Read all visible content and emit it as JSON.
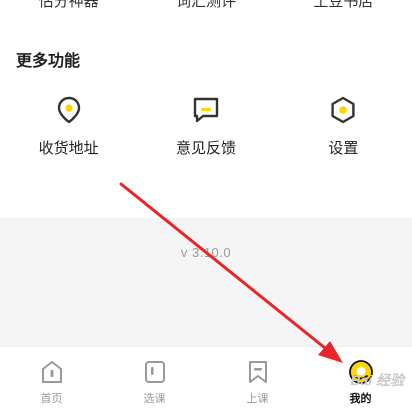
{
  "top_row": {
    "items": [
      "估分神器",
      "词汇测评",
      "土豆书店"
    ]
  },
  "more_features": {
    "title": "更多功能",
    "items": [
      {
        "label": "收货地址",
        "icon": "location-pin-icon"
      },
      {
        "label": "意见反馈",
        "icon": "feedback-icon"
      },
      {
        "label": "设置",
        "icon": "settings-icon"
      }
    ]
  },
  "version": "v 3.10.0",
  "tabbar": {
    "tabs": [
      {
        "label": "首页",
        "icon": "home-icon",
        "active": false
      },
      {
        "label": "选课",
        "icon": "course-select-icon",
        "active": false
      },
      {
        "label": "上课",
        "icon": "bookmark-icon",
        "active": false
      },
      {
        "label": "我的",
        "icon": "profile-smile-icon",
        "active": true
      }
    ]
  },
  "watermark": "Bai 经验",
  "colors": {
    "accent_yellow": "#ffd500",
    "icon_stroke": "#333333",
    "tab_inactive": "#999999",
    "arrow_red": "#e8262a",
    "background_gray": "#f5f5f5"
  }
}
